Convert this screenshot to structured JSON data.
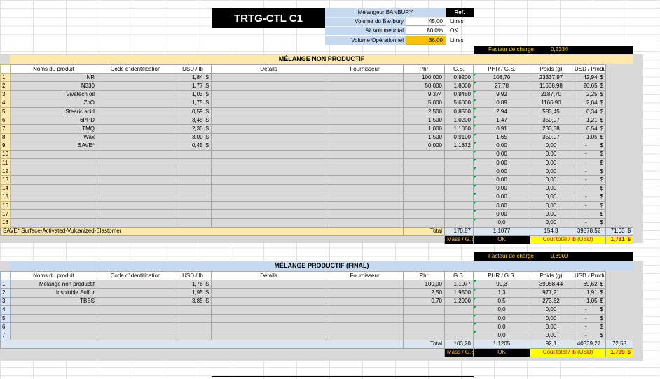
{
  "header": {
    "title": "TRTG-CTL C1",
    "rows": [
      {
        "label": "Mélangeur BANBURY",
        "value": "",
        "unit": "Ref."
      },
      {
        "label": "Volume du Banbury",
        "value": "45,00",
        "unit": "Litres"
      },
      {
        "label": "% Volume total",
        "value": "80,0%",
        "unit": "OK"
      },
      {
        "label": "Volume Opérationnel",
        "value": "36,00",
        "unit": "Litres"
      }
    ]
  },
  "columns": [
    "Noms du produit",
    "Code d'identification",
    "USD / lb",
    "Détails",
    "Fournisseur",
    "Phr",
    "G.S.",
    "PHR / G.S.",
    "Poids (g)",
    "USD / Produit"
  ],
  "section1": {
    "title": "MÉLANGE NON PRODUCTIF",
    "charge_label": "Facteur de charge",
    "charge_value": "0,2334",
    "rows": [
      {
        "n": "1",
        "name": "NR",
        "usd": "1,84",
        "phr": "100,000",
        "gs": "0,9200",
        "phrgs": "108,70",
        "poids": "23337,97",
        "prod": "42,94"
      },
      {
        "n": "2",
        "name": "N330",
        "usd": "1,77",
        "phr": "50,000",
        "gs": "1,8000",
        "phrgs": "27,78",
        "poids": "11668,98",
        "prod": "20,65"
      },
      {
        "n": "3",
        "name": "Vivatech oil",
        "usd": "1,03",
        "phr": "9,374",
        "gs": "0,9450",
        "phrgs": "9,92",
        "poids": "2187,70",
        "prod": "2,25"
      },
      {
        "n": "4",
        "name": "ZnO",
        "usd": "1,75",
        "phr": "5,000",
        "gs": "5,6000",
        "phrgs": "0,89",
        "poids": "1166,90",
        "prod": "2,04"
      },
      {
        "n": "5",
        "name": "Stearic acid",
        "usd": "0,59",
        "phr": "2,500",
        "gs": "0,8500",
        "phrgs": "2,94",
        "poids": "583,45",
        "prod": "0,34"
      },
      {
        "n": "6",
        "name": "6PPD",
        "usd": "3,45",
        "phr": "1,500",
        "gs": "1,0200",
        "phrgs": "1,47",
        "poids": "350,07",
        "prod": "1,21"
      },
      {
        "n": "7",
        "name": "TMQ",
        "usd": "2,30",
        "phr": "1,000",
        "gs": "1,1000",
        "phrgs": "0,91",
        "poids": "233,38",
        "prod": "0,54"
      },
      {
        "n": "8",
        "name": "Wax",
        "usd": "3,00",
        "phr": "1,500",
        "gs": "0,9100",
        "phrgs": "1,65",
        "poids": "350,07",
        "prod": "1,05"
      },
      {
        "n": "9",
        "name": "SAVE*",
        "usd": "0,45",
        "phr": "0,000",
        "gs": "1,1872",
        "phrgs": "0,00",
        "poids": "0,00",
        "prod": "-"
      },
      {
        "n": "10",
        "name": "",
        "usd": "",
        "phr": "",
        "gs": "",
        "phrgs": "0,00",
        "poids": "0,00",
        "prod": "-"
      },
      {
        "n": "11",
        "name": "",
        "usd": "",
        "phr": "",
        "gs": "",
        "phrgs": "0,00",
        "poids": "0,00",
        "prod": "-"
      },
      {
        "n": "12",
        "name": "",
        "usd": "",
        "phr": "",
        "gs": "",
        "phrgs": "0,00",
        "poids": "0,00",
        "prod": "-"
      },
      {
        "n": "13",
        "name": "",
        "usd": "",
        "phr": "",
        "gs": "",
        "phrgs": "0,00",
        "poids": "0,00",
        "prod": "-"
      },
      {
        "n": "14",
        "name": "",
        "usd": "",
        "phr": "",
        "gs": "",
        "phrgs": "0,00",
        "poids": "0,00",
        "prod": "-"
      },
      {
        "n": "15",
        "name": "",
        "usd": "",
        "phr": "",
        "gs": "",
        "phrgs": "0,00",
        "poids": "0,00",
        "prod": "-"
      },
      {
        "n": "16",
        "name": "",
        "usd": "",
        "phr": "",
        "gs": "",
        "phrgs": "0,00",
        "poids": "0,00",
        "prod": "-"
      },
      {
        "n": "17",
        "name": "",
        "usd": "",
        "phr": "",
        "gs": "",
        "phrgs": "0,00",
        "poids": "0,00",
        "prod": "-"
      },
      {
        "n": "18",
        "name": "",
        "usd": "",
        "phr": "",
        "gs": "",
        "phrgs": "0,0",
        "poids": "0,00",
        "prod": "-"
      }
    ],
    "footnote": "SAVE* Surface-Activated-Vulcanized-Elastomer",
    "total_label": "Total",
    "total": {
      "phr": "170,87",
      "gs": "1,1077",
      "phrgs": "154,3",
      "poids": "39878,52",
      "prod": "71,03"
    },
    "mass_label": "Mass / G.S.",
    "mass_ok": "OK",
    "cost_label": "Coût total / lb (USD)",
    "cost_value": "1,781"
  },
  "section2": {
    "title": "MÉLANGE PRODUCTIF (FINAL)",
    "charge_label": "Facteur de charge",
    "charge_value": "0,3909",
    "rows": [
      {
        "n": "1",
        "name": "Mélange non productif",
        "usd": "1,78",
        "phr": "100,00",
        "gs": "1,1077",
        "phrgs": "90,3",
        "poids": "39088,44",
        "prod": "69,62"
      },
      {
        "n": "2",
        "name": "Insoluble Sulfur",
        "usd": "1,95",
        "phr": "2,50",
        "gs": "1,9500",
        "phrgs": "1,3",
        "poids": "977,21",
        "prod": "1,91"
      },
      {
        "n": "3",
        "name": "TBBS",
        "usd": "3,85",
        "phr": "0,70",
        "gs": "1,2900",
        "phrgs": "0,5",
        "poids": "273,62",
        "prod": "1,05"
      },
      {
        "n": "4",
        "name": "",
        "usd": "",
        "phr": "",
        "gs": "",
        "phrgs": "0,0",
        "poids": "0,00",
        "prod": "-"
      },
      {
        "n": "5",
        "name": "",
        "usd": "",
        "phr": "",
        "gs": "",
        "phrgs": "0,0",
        "poids": "0,00",
        "prod": "-"
      },
      {
        "n": "6",
        "name": "",
        "usd": "",
        "phr": "",
        "gs": "",
        "phrgs": "0,0",
        "poids": "0,00",
        "prod": "-"
      },
      {
        "n": "7",
        "name": "",
        "usd": "",
        "phr": "",
        "gs": "",
        "phrgs": "0,0",
        "poids": "0,00",
        "prod": "-"
      }
    ],
    "total_label": "Total",
    "total": {
      "phr": "103,20",
      "gs": "1,1205",
      "phrgs": "92,1",
      "poids": "40339,27",
      "prod": "72,58"
    },
    "mass_label": "Mass / G.S.",
    "mass_ok": "OK",
    "cost_label": "Coût total / lb (USD)",
    "cost_value": "1,799"
  },
  "currency": "$",
  "colors": {
    "section1_band": "#fde9a9",
    "section2_band": "#c5d9f1",
    "highlight_yellow": "#ffff00",
    "highlight_orange": "#ffc000"
  }
}
